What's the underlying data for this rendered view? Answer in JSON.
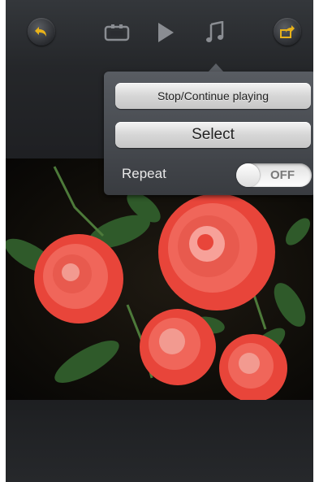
{
  "toolbar": {
    "back_icon": "undo-arrow-icon",
    "slideshow_icon": "slideshow-icon",
    "play_icon": "play-icon",
    "music_icon": "music-note-icon",
    "share_icon": "share-icon",
    "accent_color": "#e8b21a"
  },
  "photo": {
    "subject": "red-roses-photo"
  },
  "popup": {
    "stop_continue_label": "Stop/Continue playing",
    "select_label": "Select",
    "repeat_label": "Repeat",
    "repeat_toggle_value": "OFF"
  }
}
